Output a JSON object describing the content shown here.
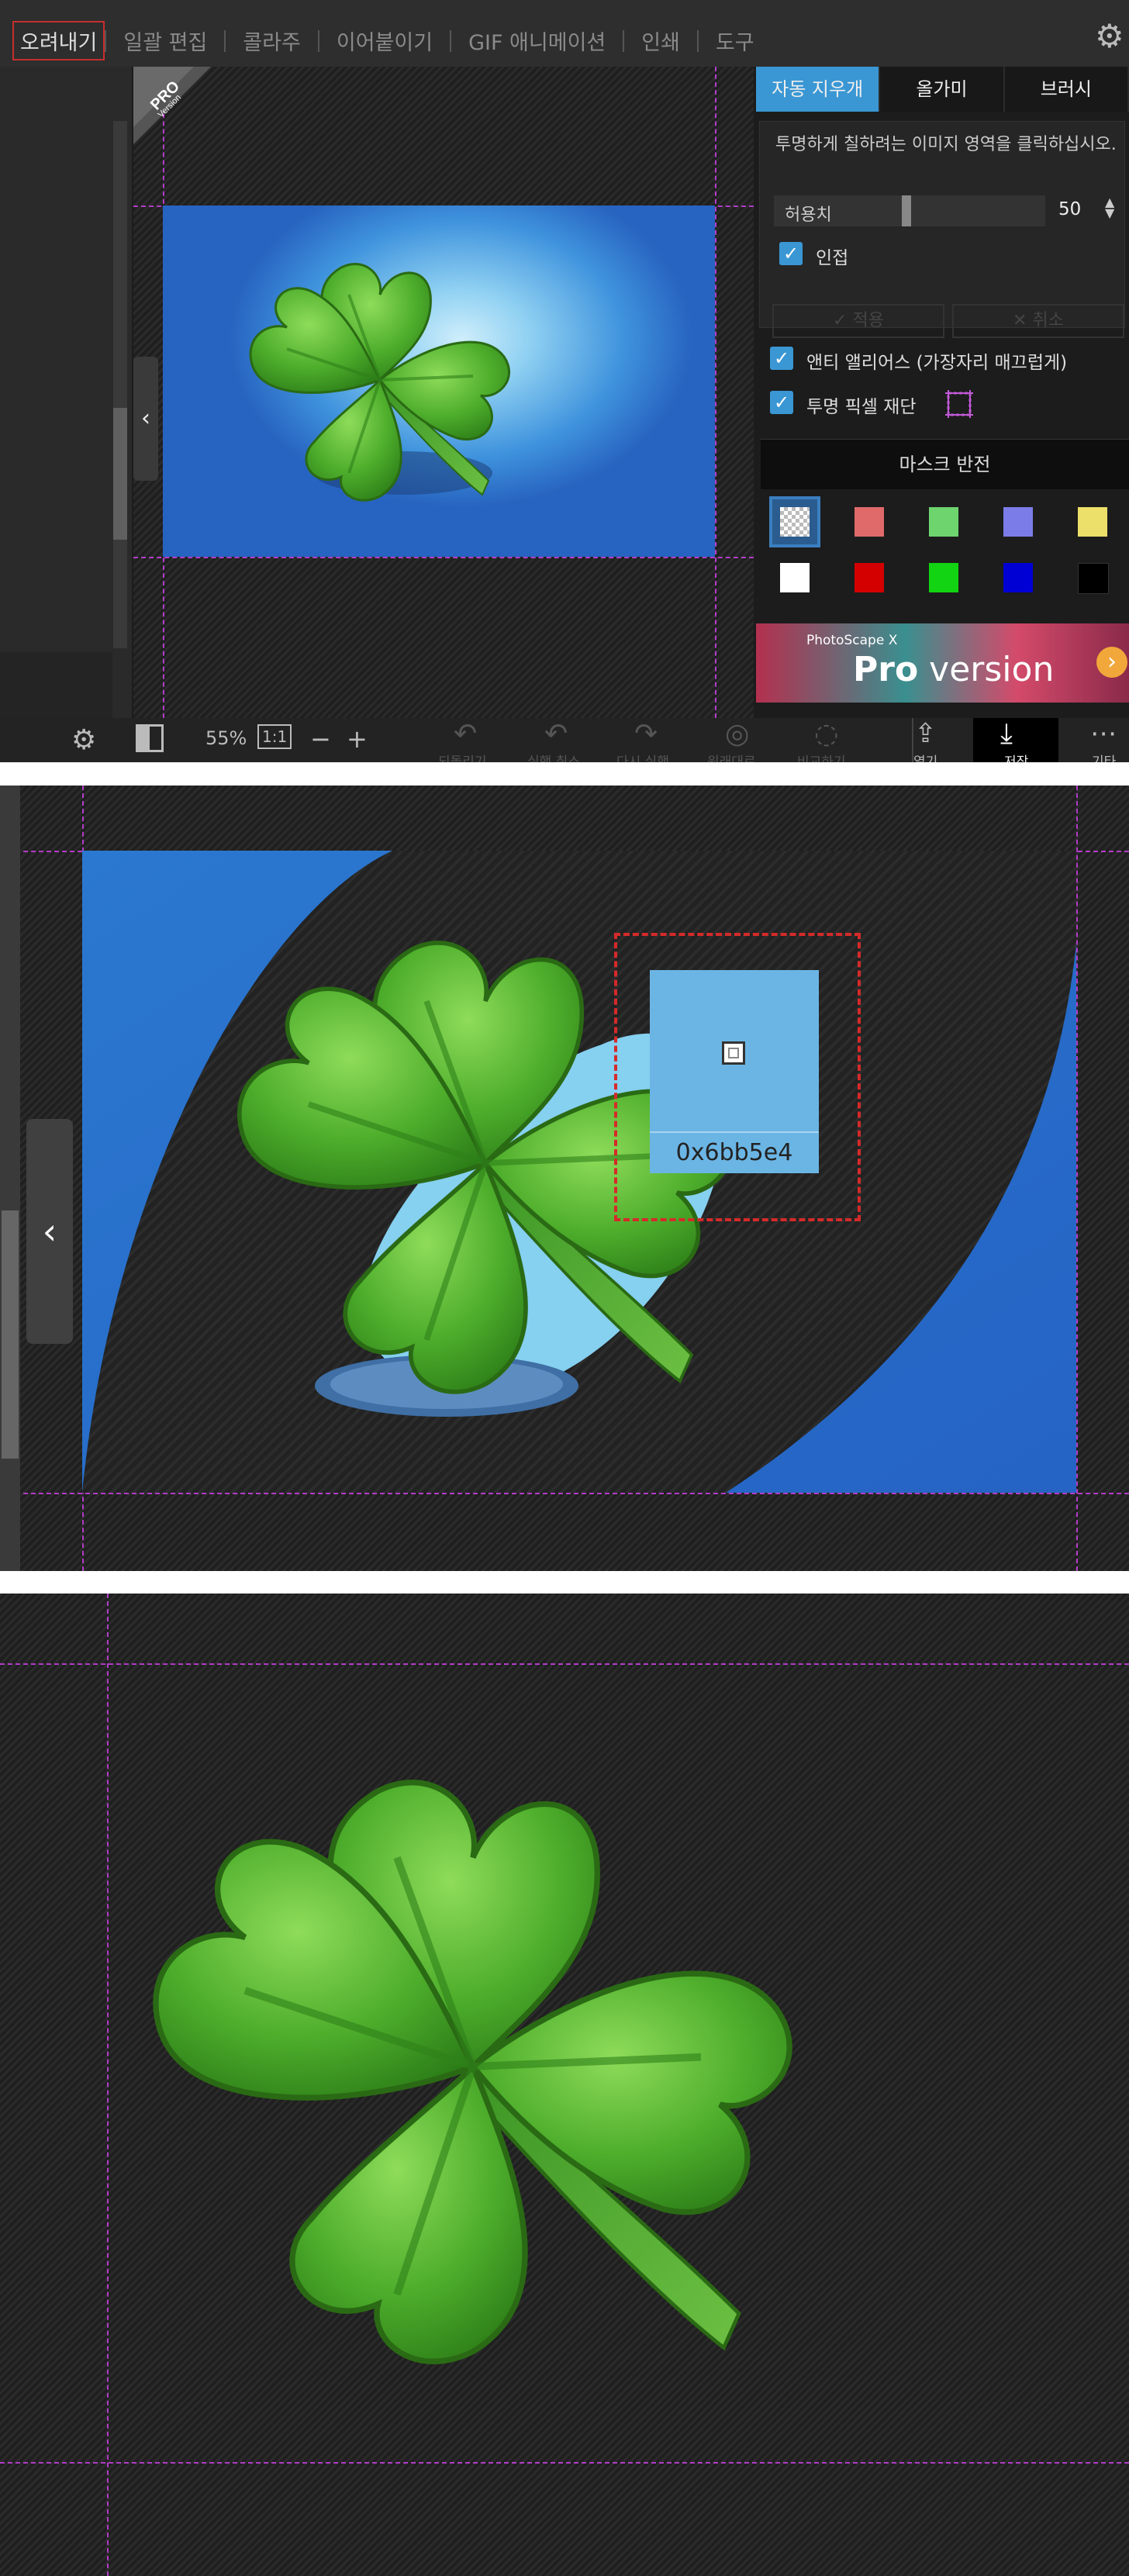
{
  "menu": {
    "tabs": [
      "오려내기",
      "일괄 편집",
      "콜라주",
      "이어붙이기",
      "GIF 애니메이션",
      "인쇄",
      "도구"
    ],
    "active": "오려내기"
  },
  "badge": {
    "top": "PRO",
    "bottom": "Version"
  },
  "right_panel": {
    "tabs": [
      "자동 지우개",
      "올가미",
      "브러시"
    ],
    "instruction": "투명하게 칠하려는 이미지 영역을 클릭하십시오.",
    "tolerance_label": "허용치",
    "tolerance_value": "50",
    "contiguous_label": "인접",
    "apply_label": "적용",
    "cancel_label": "취소",
    "antialias_label": "앤티 앨리어스 (가장자리 매끄럽게)",
    "trim_label": "투명 픽셀 재단",
    "mask_invert_label": "마스크 반전",
    "swatches": [
      {
        "color": "checker",
        "selected": true
      },
      {
        "color": "#e06a6a"
      },
      {
        "color": "#6ed46e"
      },
      {
        "color": "#7c7ce8"
      },
      {
        "color": "#ece06a"
      },
      {
        "color": "#ffffff"
      },
      {
        "color": "#d40000"
      },
      {
        "color": "#12d412"
      },
      {
        "color": "#0000d4"
      },
      {
        "color": "#000000"
      }
    ],
    "ad": {
      "small": "PhotoScape X",
      "pro": "Pro",
      "version": " version"
    }
  },
  "bottom_bar": {
    "zoom": "55%",
    "one_to_one": "1:1",
    "minus": "−",
    "plus": "+",
    "labels": [
      "되돌리기",
      "실행 취소",
      "다시 실행",
      "원래대로",
      "비교하기"
    ],
    "open_label": "열기",
    "save_label": "저장",
    "more_label": "기타"
  },
  "picker": {
    "color_hex": "0x6bb5e4",
    "swatch": "#6bb5e4"
  },
  "colors": {
    "accent": "#3a97d4",
    "guide": "#b33cc9",
    "picker_frame": "#d52a2a"
  },
  "icons": [
    "settings-icon",
    "checkbox-check-icon",
    "trim-crop-icon",
    "collapse-arrow-icon",
    "undo-icon",
    "redo-icon",
    "open-icon",
    "save-icon",
    "more-icon"
  ]
}
